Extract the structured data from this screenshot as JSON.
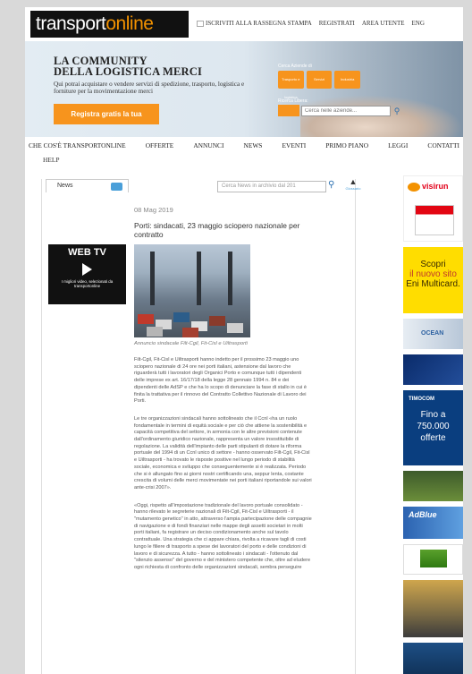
{
  "header": {
    "logo_left": "transport",
    "logo_right": "online",
    "top_nav": [
      "ISCRIVITI ALLA RASSEGNA STAMPA",
      "REGISTRATI",
      "AREA UTENTE",
      "ENG"
    ]
  },
  "banner": {
    "headline_1": "LA COMMUNITY",
    "headline_2": "DELLA LOGISTICA MERCI",
    "description": "Qui potrai acquistare o vendere servizi di spedizione, trasporto, logistica e forniture per la movimentazione merci",
    "cta_label": "Registra gratis la tua",
    "search_companies_label": "Cerca Aziende di",
    "search_buttons": [
      "Trasporto e logistica",
      "Servizi",
      "Industria"
    ],
    "free_search_label": "Ricerca Libera:",
    "free_search_placeholder": "Cerca nelle aziende..."
  },
  "main_nav": [
    "CHE COS'È TRANSPORTONLINE",
    "OFFERTE",
    "ANNUNCI",
    "NEWS",
    "EVENTI",
    "PRIMO PIANO",
    "LEGGI",
    "CONTATTI"
  ],
  "main_nav_second": "HELP",
  "news": {
    "tab_label": "News",
    "search_placeholder": "Cerca News in archivio dal 201",
    "glossary_label": "Glossario"
  },
  "webtv": {
    "title": "WEB TV",
    "subtitle": "I migliori video, selezionati da transportonline"
  },
  "article": {
    "date": "08 Mag 2019",
    "title": "Porti: sindacati, 23 maggio sciopero nazionale per contratto",
    "caption": "Annuncio sindacale Filt-Cgil, Fit-Cisl e Uiltrasporti",
    "paragraphs": [
      "Filt-Cgil, Fit-Cisl e Uiltrasporti hanno indetto per il prossimo 23 maggio uno sciopero nazionale di 24 ore nei porti italiani, astensione dal lavoro che riguarderà tutti i lavoratori degli Organici Porto e comunque tutti i dipendenti delle imprese ex art. 16/17/18 della legge 28 gennaio 1994 n. 84 e dei dipendenti delle AdSP e che ha lo scopo di denunciare la fase di stallo in cui è finita la trattativa per il rinnovo del Contratto Collettivo Nazionale di Lavoro dei Porti.",
      "Le tre organizzazioni sindacali hanno sottolineato che il Ccnl «ha un ruolo fondamentale in termini di equità sociale e per ciò che attiene la sostenibilità e capacità competitiva del settore, in armonia con le altre previsioni contenute dall'ordinamento giuridico nazionale, rappresenta un valore insostituibile di regolazione. La validità dell'impianto delle parti stipulanti di dotare la riforma portuale del 1994 di un Ccnl unico di settore - hanno osservato Filt-Cgil, Fit-Cisl e Uiltrasporti - ha trovato le risposte positive nel lungo periodo di stabilità sociale, economica e sviluppo che conseguentemente si è realizzata. Periodo che si è allungato fino ai giorni nostri certificando una, seppur lenta, costante crescita di volumi delle merci movimentate nei porti italiani riportandole sui valori ante-crisi 2007».",
      "«Oggi, rispetto all'impostazione tradizionale del lavoro portuale consolidato - hanno rilevato le segreterie nazionali di Filt-Cgil, Fit-Cisl e Uiltrasporti - il \"mutamento genetico\" in atto, attraverso l'ampia partecipazione delle compagnie di navigazione e di fondi finanziari nelle mappe degli assetti societari in molti porti italiani, fa registrare un deciso condizionamento anche sul tavolo contrattuale. Una strategia che ci appare chiara, rivolta a ricavare tagli di costi lungo le filiere di trasporto a spese dei lavoratori del porto e delle condizioni di lavoro e di sicurezza. A tutto - hanno sottolineato i sindacati - l'ottenuto dal \"silenzio assenso\" del governo e del ministero competente che, oltre ad eludere ogni richiesta di confronto delle organizzazioni sindacali, sembra perseguire"
    ]
  },
  "sidebar": {
    "visirun_brand": "visirun",
    "eni_line1": "Scopri",
    "eni_line2": "il nuovo sito",
    "eni_line3": "Eni Multicard.",
    "ocean_label": "OCEAN",
    "timocom_header": "TIMOCOM",
    "timocom_line1": "Fino a",
    "timocom_line2": "750.000",
    "timocom_line3": "offerte",
    "adblue_label": "AdBlue"
  }
}
